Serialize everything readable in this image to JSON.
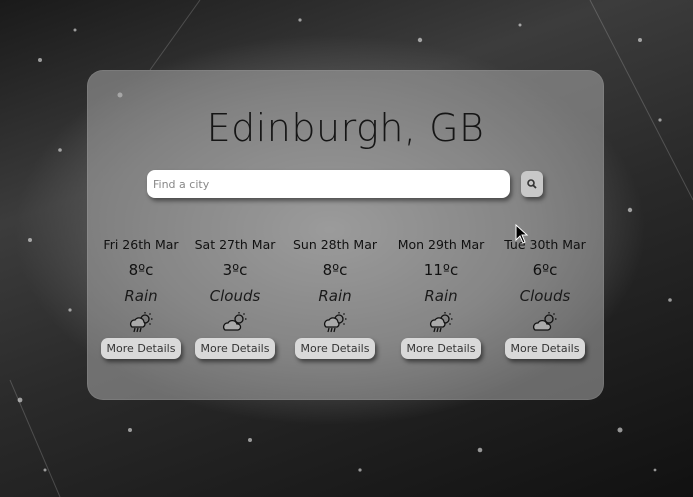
{
  "location": "Edinburgh, GB",
  "search": {
    "placeholder": "Find a city"
  },
  "forecast": [
    {
      "date": "Fri 26th Mar",
      "temp": "8ºc",
      "condition": "Rain",
      "icon": "rain-sun-icon",
      "button": "More Details"
    },
    {
      "date": "Sat 27th Mar",
      "temp": "3ºc",
      "condition": "Clouds",
      "icon": "cloud-sun-icon",
      "button": "More Details"
    },
    {
      "date": "Sun 28th Mar",
      "temp": "8ºc",
      "condition": "Rain",
      "icon": "rain-sun-icon",
      "button": "More Details"
    },
    {
      "date": "Mon 29th Mar",
      "temp": "11ºc",
      "condition": "Rain",
      "icon": "rain-sun-icon",
      "button": "More Details"
    },
    {
      "date": "Tue 30th Mar",
      "temp": "6ºc",
      "condition": "Clouds",
      "icon": "cloud-sun-icon",
      "button": "More Details"
    }
  ]
}
